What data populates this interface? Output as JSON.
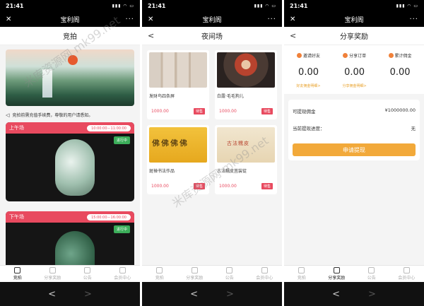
{
  "status_time": "21:41",
  "status_icons": "▮▮▮ ◠ ▭",
  "app_title": "宝利阁",
  "close_glyph": "✕",
  "more_glyph": "···",
  "back_glyph": "<",
  "screen1": {
    "nav_title": "竞拍",
    "notice": "竞拍前需充值手续费，尊敬的用户请悉知。",
    "sessions": [
      {
        "name": "上午场",
        "time": "10:00:00－11:00:00",
        "status": "进行中"
      },
      {
        "name": "下午场",
        "time": "15:00:00－16:00:00",
        "status": "进行中"
      }
    ]
  },
  "screen2": {
    "nav_title": "夜间场",
    "items": [
      {
        "name": "发财鸟四条屏",
        "price": "1000.00",
        "status": "待售"
      },
      {
        "name": "白露·毛毛狗儿",
        "price": "1000.00",
        "status": "待售"
      },
      {
        "name": "斑禅书法作品",
        "price": "1000.00",
        "status": "待售"
      },
      {
        "name": "古法糯皮苴装锭",
        "price": "1000.00",
        "status": "待售"
      }
    ],
    "calligraphy_a": "佛佛佛佛",
    "calligraphy_b": "古法糯皮"
  },
  "screen3": {
    "nav_title": "分享奖励",
    "shares": [
      {
        "label": "邀请好友",
        "value": "0.00",
        "link": "好友佣金明细>"
      },
      {
        "label": "分享订单",
        "value": "0.00",
        "link": "分享佣金明细>"
      },
      {
        "label": "累计佣金",
        "value": "0.00",
        "link": ""
      }
    ],
    "withdrawable_label": "可提现佣金",
    "withdrawable_value": "¥1000000.00",
    "progress_label": "当前提现进度：",
    "progress_value": "无",
    "apply_button": "申请提现"
  },
  "tabs": [
    {
      "label": "竞拍"
    },
    {
      "label": "分享奖励"
    },
    {
      "label": "公告"
    },
    {
      "label": "会员中心"
    }
  ],
  "sys_back": "<",
  "sys_forward": ">",
  "watermark_a": "米库资源网 mk99.net",
  "watermark_b": "米库资源网 mk99.net",
  "colors": {
    "accent_red": "#e84a5f",
    "accent_orange": "#f2a93a",
    "status_green": "#3cae5a"
  }
}
